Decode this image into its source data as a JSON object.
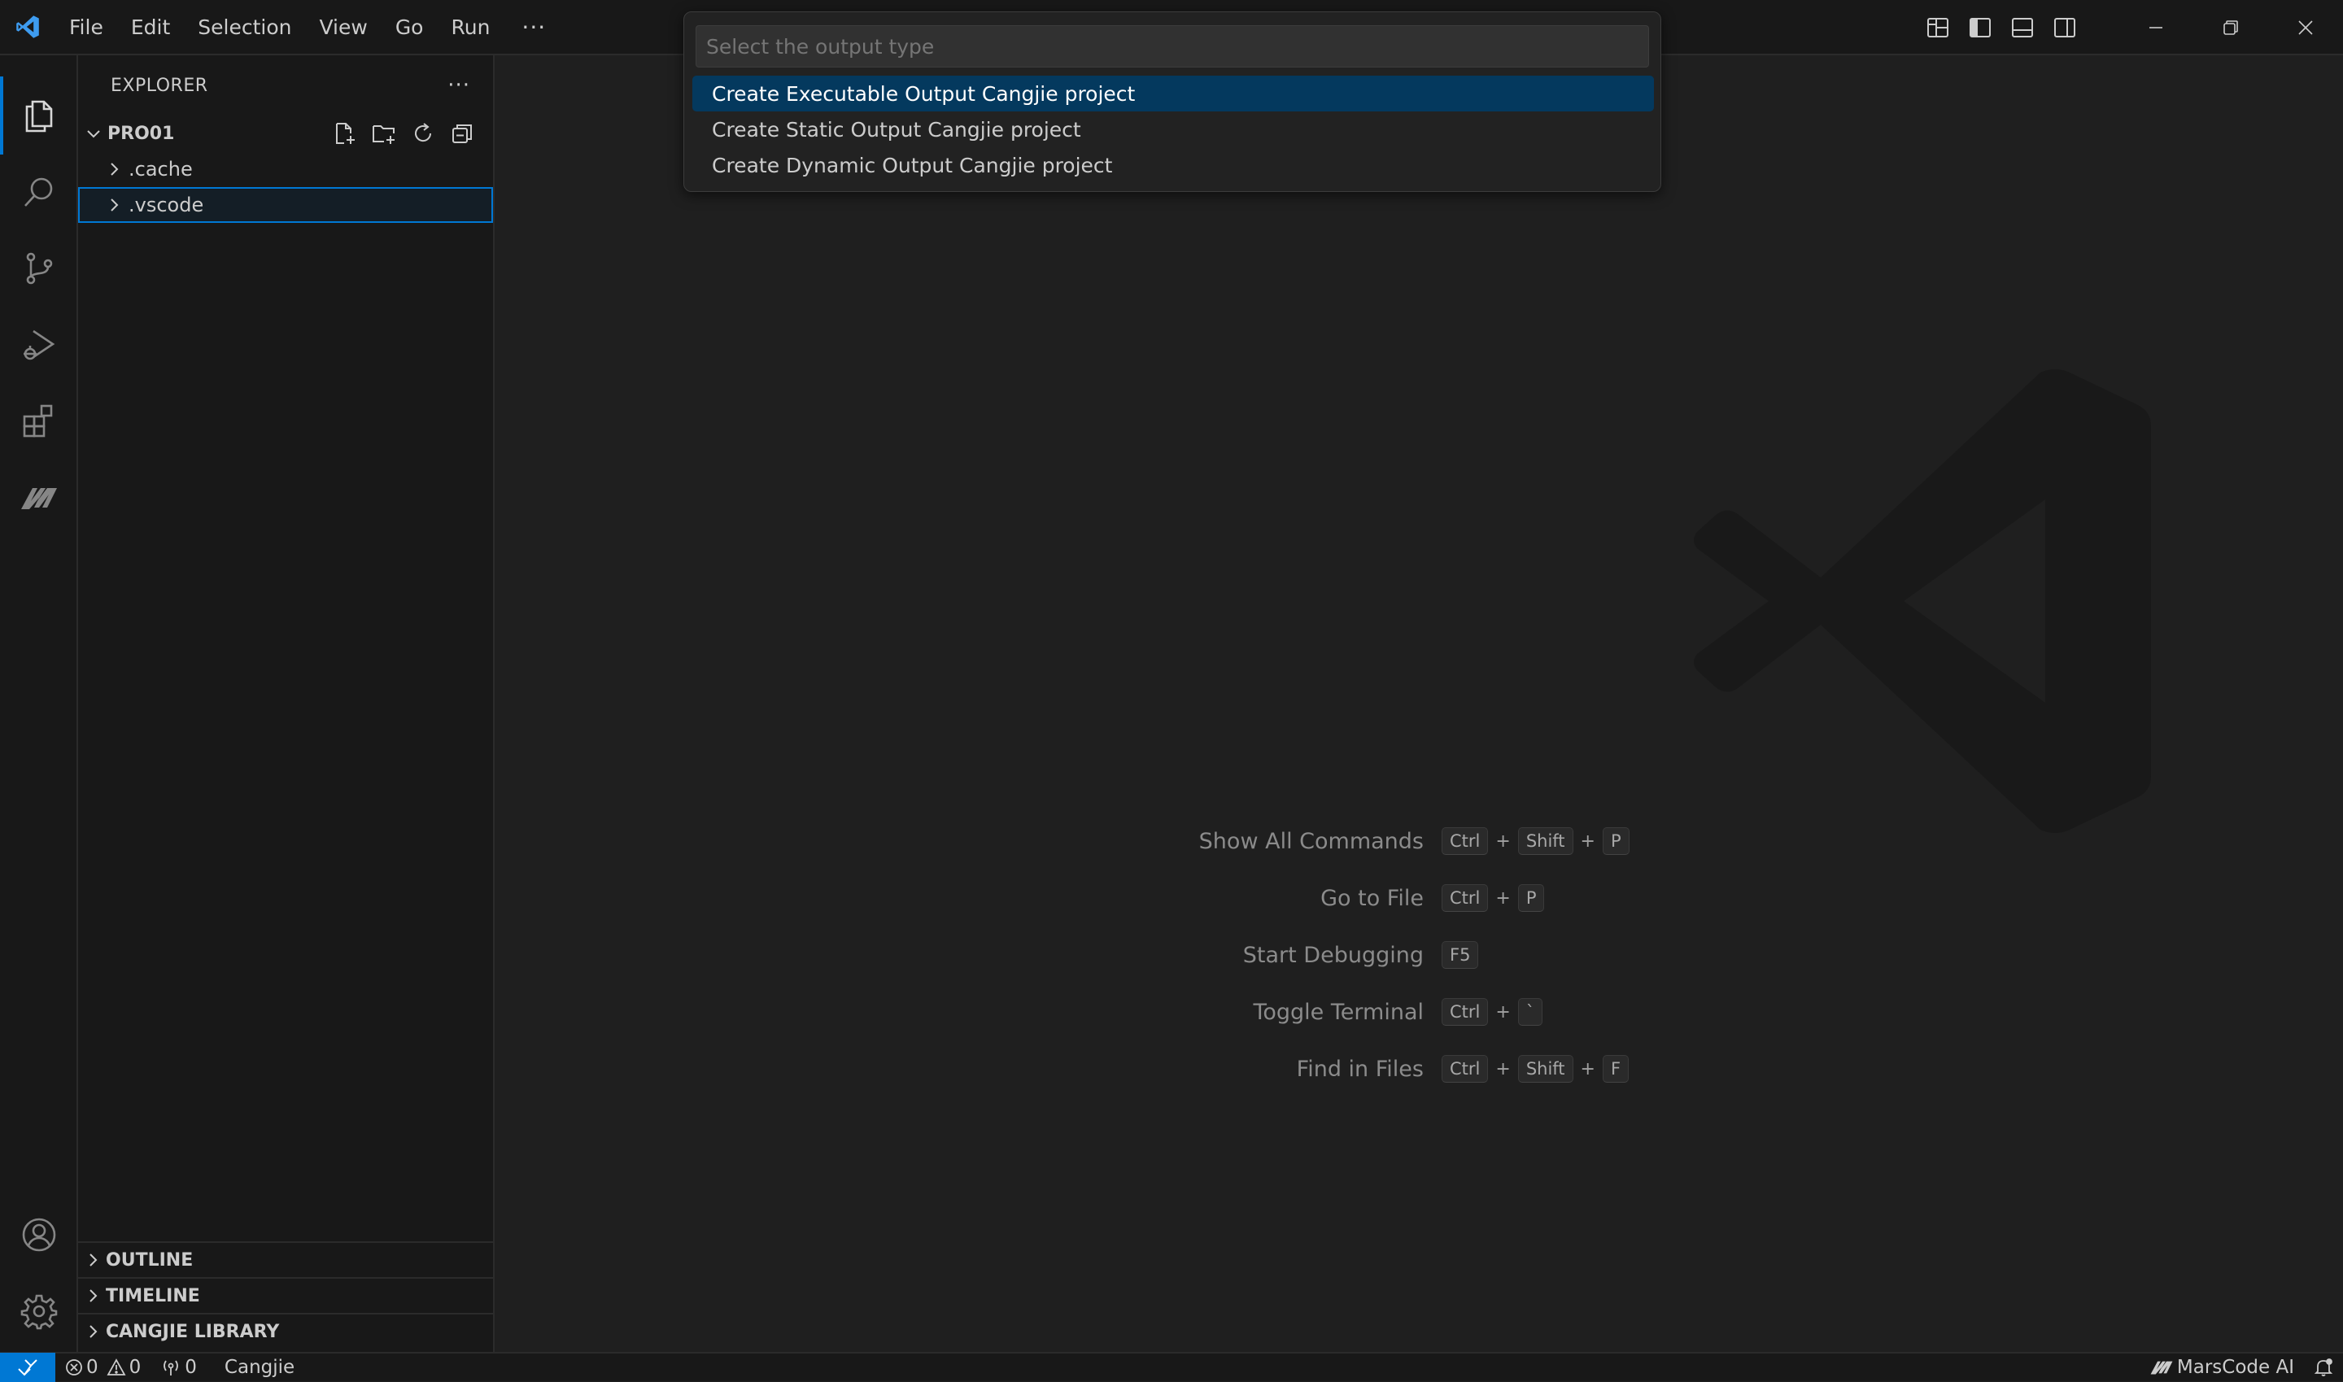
{
  "titlebar": {
    "menu": [
      "File",
      "Edit",
      "Selection",
      "View",
      "Go",
      "Run"
    ],
    "more": "···"
  },
  "explorer": {
    "title": "EXPLORER",
    "more": "···",
    "root": "PRO01",
    "items": [
      ".cache",
      ".vscode"
    ],
    "sections": [
      "OUTLINE",
      "TIMELINE",
      "CANGJIE LIBRARY"
    ]
  },
  "quickpick": {
    "placeholder": "Select the output type",
    "items": [
      "Create Executable Output Cangjie project",
      "Create Static Output Cangjie project",
      "Create Dynamic Output Cangjie project"
    ]
  },
  "shortcuts": [
    {
      "label": "Show All Commands",
      "keys": [
        "Ctrl",
        "Shift",
        "P"
      ]
    },
    {
      "label": "Go to File",
      "keys": [
        "Ctrl",
        "P"
      ]
    },
    {
      "label": "Start Debugging",
      "keys": [
        "F5"
      ]
    },
    {
      "label": "Toggle Terminal",
      "keys": [
        "Ctrl",
        "`"
      ]
    },
    {
      "label": "Find in Files",
      "keys": [
        "Ctrl",
        "Shift",
        "F"
      ]
    }
  ],
  "statusbar": {
    "errors": "0",
    "warnings": "0",
    "ports": "0",
    "language": "Cangjie",
    "marscode": "MarsCode AI"
  },
  "colors": {
    "accent": "#0078d4",
    "selection": "#04395e",
    "background": "#1f1f1f",
    "chrome": "#181818"
  }
}
